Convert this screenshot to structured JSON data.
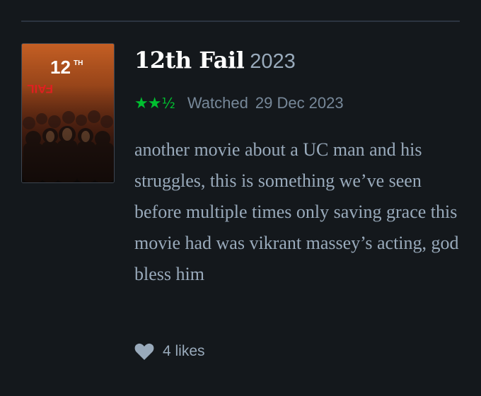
{
  "review": {
    "film_title": "12th Fail",
    "film_year": "2023",
    "poster": {
      "title_line1": "12",
      "title_line1_sup": "TH",
      "title_line2": "FAIL"
    },
    "rating": {
      "stars": 2.5,
      "full_stars": "★★",
      "half_star": "½",
      "color": "#00c030"
    },
    "watched_label": "Watched",
    "watched_date": "29 Dec 2023",
    "text": "another movie about a UC man and his struggles, this is something we’ve seen before multiple times only saving grace this movie had was vikrant massey’s acting, god bless him",
    "likes_icon": "heart-icon",
    "likes_text": "4 likes"
  },
  "colors": {
    "background": "#14181c",
    "title": "#ffffff",
    "muted": "#99aabb",
    "meta": "#778899",
    "divider": "#2c3440"
  }
}
